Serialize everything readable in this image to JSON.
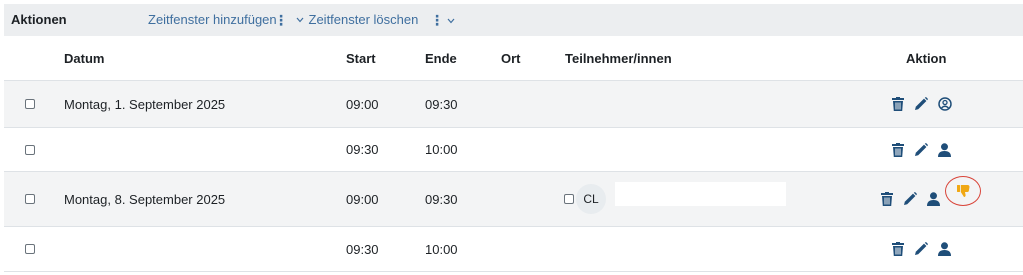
{
  "toolbar": {
    "title": "Aktionen",
    "add_slot": "Zeitfenster hinzufügen",
    "kebab": "⋮",
    "delete_slot": "Zeitfenster löschen",
    "chevron": "v"
  },
  "table": {
    "headers": {
      "date": "Datum",
      "start": "Start",
      "end": "Ende",
      "location": "Ort",
      "participants": "Teilnehmer/innen",
      "action": "Aktion"
    },
    "rows": [
      {
        "date": "Montag, 1. September 2025",
        "start": "09:00",
        "end": "09:30",
        "participant_initials": ""
      },
      {
        "date": "",
        "start": "09:30",
        "end": "10:00",
        "participant_initials": ""
      },
      {
        "date": "Montag, 8. September 2025",
        "start": "09:00",
        "end": "09:30",
        "participant_initials": "CL"
      },
      {
        "date": "",
        "start": "09:30",
        "end": "10:00",
        "participant_initials": ""
      }
    ]
  },
  "colors": {
    "icon": "#1f4e79",
    "link": "#3f6f9f",
    "thumb": "#f0a814",
    "highlight": "#d9453a"
  },
  "icons": [
    "trash-icon",
    "pencil-icon",
    "user-circle-icon",
    "user-icon",
    "thumbs-down-icon",
    "chevron-down-icon",
    "kebab-icon"
  ]
}
